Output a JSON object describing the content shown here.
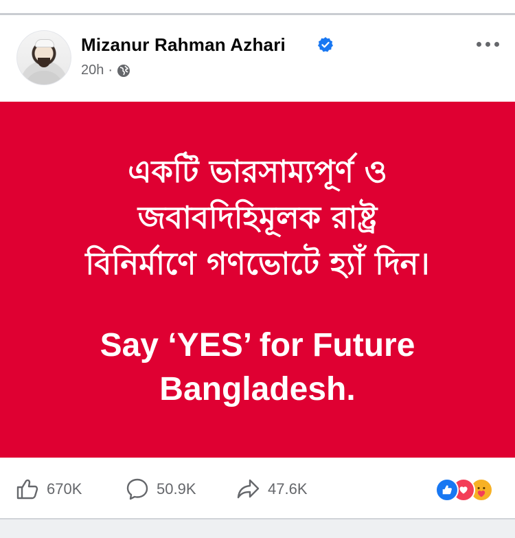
{
  "post": {
    "author": "Mizanur Rahman Azhari",
    "time": "20h",
    "separator": "·",
    "image_text_bn": [
      "একটি ভারসাম্যপূর্ণ ও",
      "জবাবদিহিমূলক রাষ্ট্র",
      "বিনির্মাণে গণভোটে হ্যাঁ দিন।"
    ],
    "image_text_en": [
      "Say ‘YES’ for Future",
      "Bangladesh."
    ],
    "background_color": "#df0032"
  },
  "actions": {
    "likes": "670K",
    "comments": "50.9K",
    "shares": "47.6K"
  },
  "icons": {
    "avatar": "profile-photo",
    "verified": "verified-badge-icon",
    "audience": "globe-icon",
    "more": "more-dots-icon",
    "like": "thumbs-up-icon",
    "comment": "comment-bubble-icon",
    "share": "share-arrow-icon",
    "reactions": [
      "like-reaction-icon",
      "love-reaction-icon",
      "care-reaction-icon"
    ]
  },
  "colors": {
    "verified": "#1877f2",
    "like_reaction": "#1877f2",
    "love_reaction": "#f33e58",
    "care_reaction": "#f7b125"
  }
}
